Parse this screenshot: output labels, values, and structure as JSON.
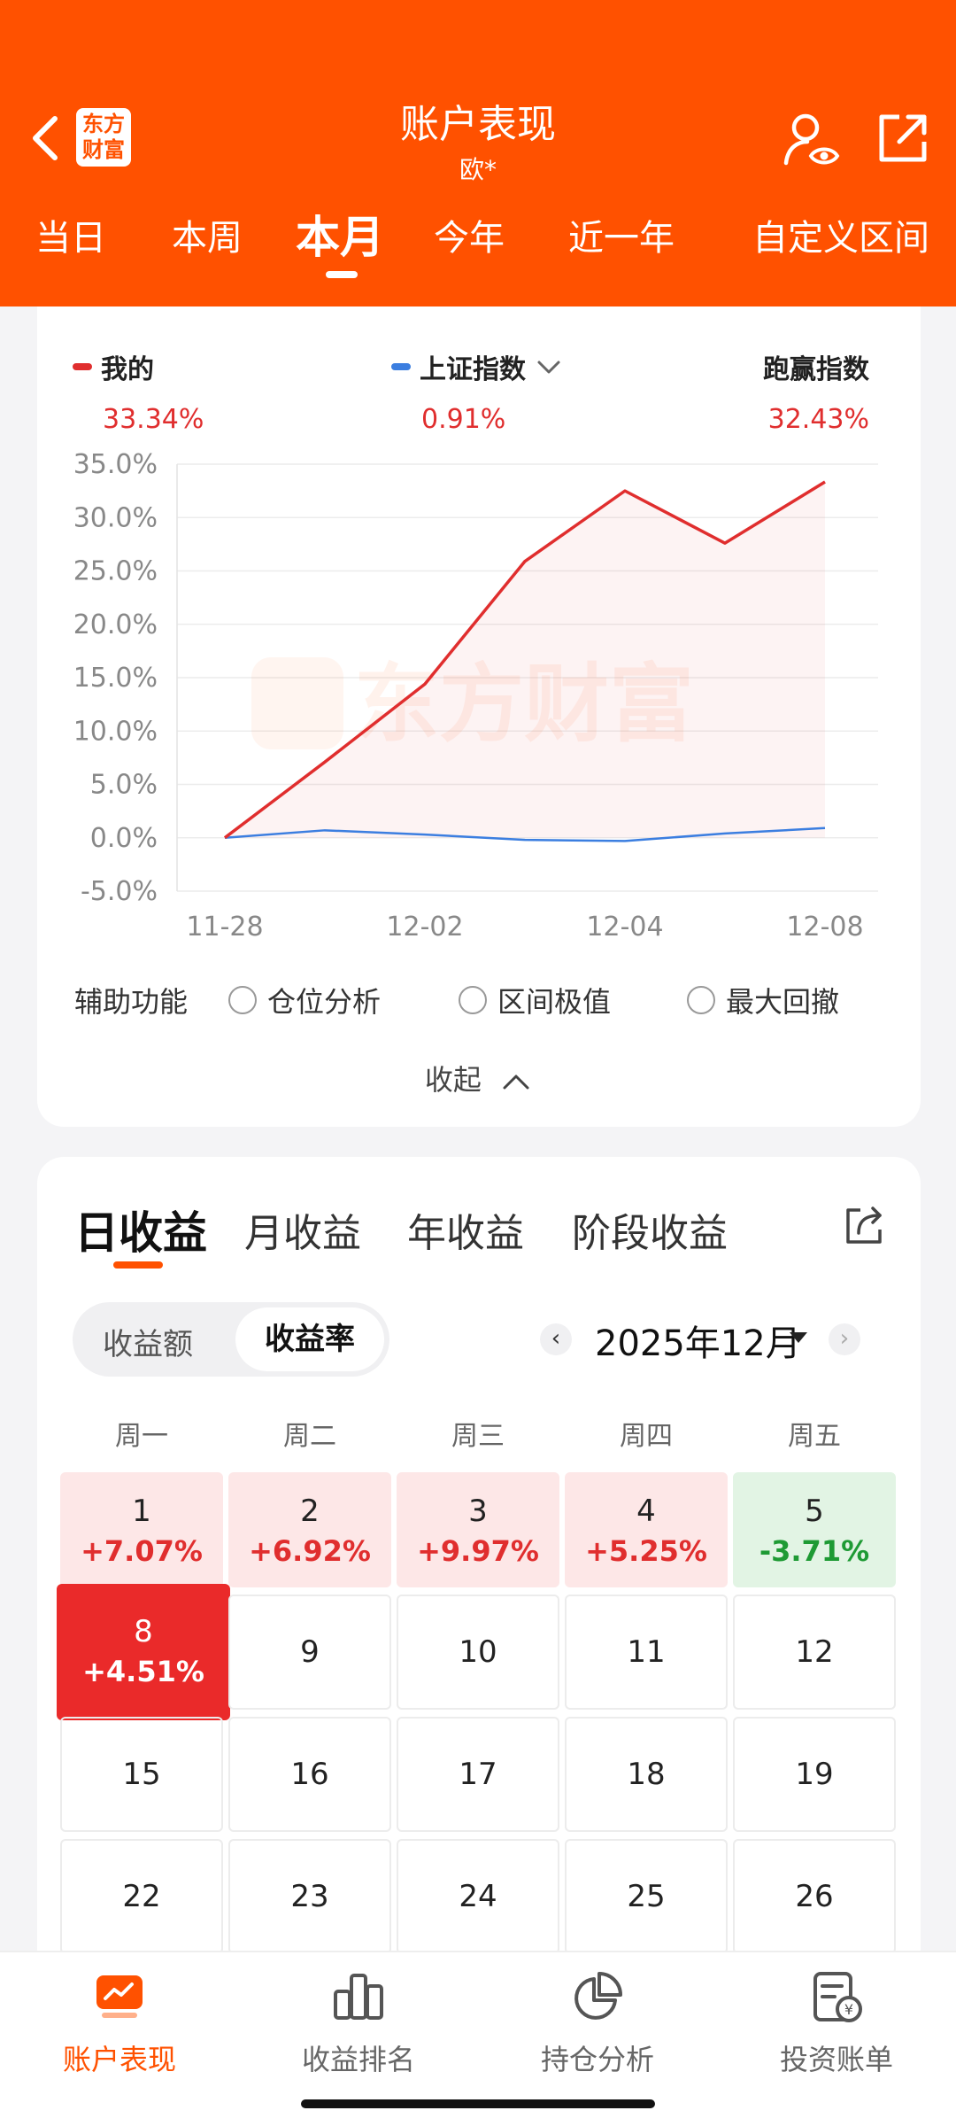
{
  "header": {
    "title": "账户表现",
    "subtitle": "欧*",
    "logo_line1": "东方",
    "logo_line2": "财富",
    "tabs": [
      "当日",
      "本周",
      "本月",
      "今年",
      "近一年",
      "自定义区间"
    ],
    "active_tab": "本月"
  },
  "legend": {
    "mine_label": "我的",
    "mine_value": "33.34%",
    "index_label": "上证指数",
    "index_value": "0.91%",
    "beat_label": "跑赢指数",
    "beat_value": "32.43%"
  },
  "colors": {
    "brand": "#ff5100",
    "mine_line": "#e02e2e",
    "index_line": "#3b7ee0",
    "up": "#e02e2e",
    "down": "#1e9a34"
  },
  "chart_data": {
    "type": "line",
    "watermark": "东方财富",
    "x_ticks": [
      "11-28",
      "12-02",
      "12-04",
      "12-08"
    ],
    "y_ticks": [
      "35.0%",
      "30.0%",
      "25.0%",
      "20.0%",
      "15.0%",
      "10.0%",
      "5.0%",
      "0.0%",
      "-5.0%"
    ],
    "ylim": [
      -5,
      35
    ],
    "dates": [
      "11-28",
      "12-01",
      "12-02",
      "12-03",
      "12-04",
      "12-05",
      "12-08"
    ],
    "series": [
      {
        "name": "我的",
        "values": [
          0.0,
          7.1,
          14.4,
          25.9,
          32.5,
          27.6,
          33.34
        ]
      },
      {
        "name": "上证指数",
        "values": [
          0.0,
          0.7,
          0.3,
          -0.2,
          -0.3,
          0.4,
          0.91
        ]
      }
    ],
    "grid": true
  },
  "aux": {
    "label": "辅助功能",
    "options": [
      "仓位分析",
      "区间极值",
      "最大回撤"
    ],
    "collapse_label": "收起"
  },
  "earnings": {
    "tabs": [
      "日收益",
      "月收益",
      "年收益",
      "阶段收益"
    ],
    "active_tab": "日收益",
    "toggle_off": "收益额",
    "toggle_on": "收益率",
    "month": "2025年12月",
    "weekdays": [
      "周一",
      "周二",
      "周三",
      "周四",
      "周五"
    ],
    "rows": [
      [
        {
          "day": "1",
          "ret": "+7.07%",
          "kind": "up"
        },
        {
          "day": "2",
          "ret": "+6.92%",
          "kind": "up"
        },
        {
          "day": "3",
          "ret": "+9.97%",
          "kind": "up"
        },
        {
          "day": "4",
          "ret": "+5.25%",
          "kind": "up"
        },
        {
          "day": "5",
          "ret": "-3.71%",
          "kind": "down"
        }
      ],
      [
        {
          "day": "8",
          "ret": "+4.51%",
          "kind": "sel"
        },
        {
          "day": "9"
        },
        {
          "day": "10"
        },
        {
          "day": "11"
        },
        {
          "day": "12"
        }
      ],
      [
        {
          "day": "15"
        },
        {
          "day": "16"
        },
        {
          "day": "17"
        },
        {
          "day": "18"
        },
        {
          "day": "19"
        }
      ],
      [
        {
          "day": "22"
        },
        {
          "day": "23"
        },
        {
          "day": "24"
        },
        {
          "day": "25"
        },
        {
          "day": "26"
        }
      ]
    ]
  },
  "bottom_nav": {
    "items": [
      {
        "label": "账户表现",
        "icon": "performance-icon",
        "active": true
      },
      {
        "label": "收益排名",
        "icon": "ranking-icon",
        "active": false
      },
      {
        "label": "持仓分析",
        "icon": "pie-icon",
        "active": false
      },
      {
        "label": "投资账单",
        "icon": "bill-icon",
        "active": false
      }
    ]
  }
}
